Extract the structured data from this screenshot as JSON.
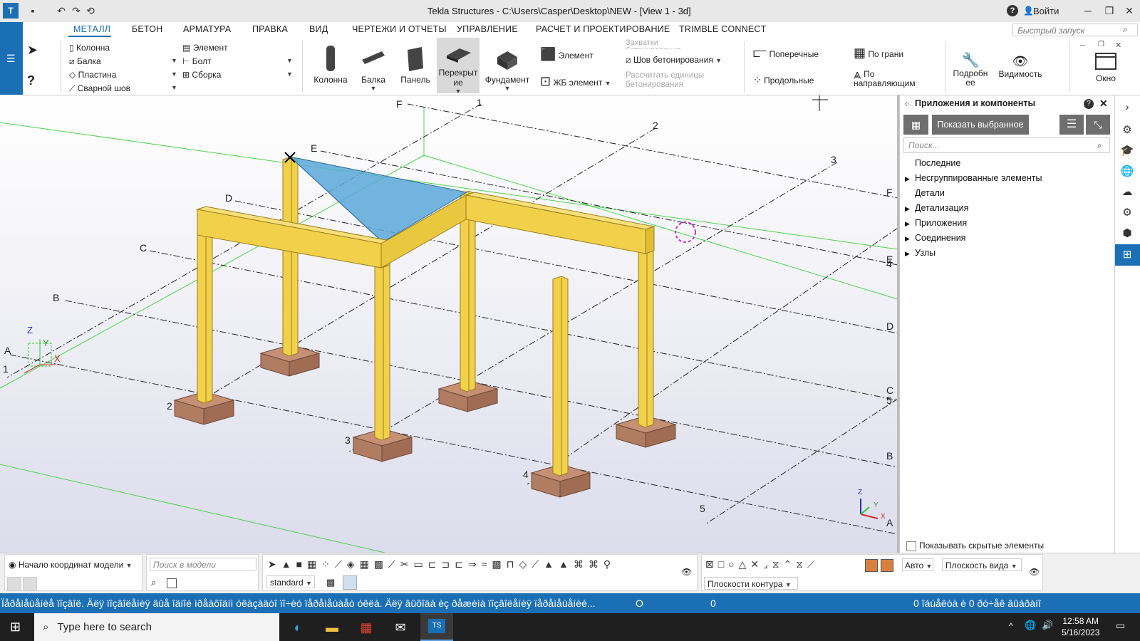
{
  "window": {
    "title": "Tekla Structures - C:\\Users\\Casper\\Desktop\\NEW - [View 1 - 3d]",
    "help": "?",
    "login": "Войти"
  },
  "tabs": [
    "МЕТАЛЛ",
    "БЕТОН",
    "АРМАТУРА",
    "ПРАВКА",
    "ВИД",
    "ЧЕРТЕЖИ И ОТЧЕТЫ",
    "УПРАВЛЕНИЕ",
    "РАСЧЕТ И ПРОЕКТИРОВАНИЕ",
    "TRIMBLE CONNECT"
  ],
  "quick_launch_placeholder": "Быстрый запуск",
  "ribbon": {
    "steel_small": [
      "Колонна",
      "Балка",
      "Пластина",
      "Сварной шов"
    ],
    "steel_small2": [
      "Элемент",
      "Болт",
      "Сборка"
    ],
    "concrete_big": [
      "Колонна",
      "Балка",
      "Панель",
      "Перекрыт ие",
      "Фундамент"
    ],
    "concrete_small": [
      "Элемент",
      "ЖБ элемент"
    ],
    "pour": [
      "Захватки бетонирования",
      "Шов бетонирования",
      "Рассчитать единицы бетонирования"
    ],
    "rebar": [
      "Поперечные",
      "Продольные",
      "По грани",
      "По направляющим"
    ],
    "view": [
      "Подробн ее",
      "Видимость",
      "Окно"
    ]
  },
  "grid_labels": {
    "letters_left": [
      "F",
      "E",
      "D",
      "C",
      "B",
      "A"
    ],
    "letters_right": [
      "F",
      "E",
      "D",
      "C",
      "B",
      "A"
    ],
    "numbers_top": [
      "1",
      "2",
      "3"
    ],
    "numbers_bottom": [
      "1",
      "2",
      "3",
      "4",
      "5"
    ],
    "numbers_right": [
      "4",
      "5"
    ]
  },
  "axes": {
    "z": "Z",
    "y": "Y",
    "x": "X"
  },
  "panel": {
    "title": "Приложения и компоненты",
    "show_selected": "Показать выбранное",
    "search_placeholder": "Поиск...",
    "tree": [
      {
        "label": "Последние",
        "expandable": false
      },
      {
        "label": "Несгруппированные элементы",
        "expandable": true
      },
      {
        "label": "Детали",
        "expandable": false
      },
      {
        "label": "Детализация",
        "expandable": true
      },
      {
        "label": "Приложения",
        "expandable": true
      },
      {
        "label": "Соединения",
        "expandable": true
      },
      {
        "label": "Узлы",
        "expandable": true
      }
    ],
    "show_hidden": "Показывать скрытые элементы"
  },
  "bottom": {
    "origin": "Начало координат модели",
    "search_model": "Поиск в модели",
    "standard": "standard",
    "auto": "Авто",
    "view_plane": "Плоскость вида",
    "contour_planes": "Плоскости контура"
  },
  "status": {
    "message": "Ïåðåìåùåíèå ïîçâîë. Äëÿ ïîçâîëåíèÿ âûå îäíîé ìðåàõîäíì óêàçàäòî ïî÷èó ïåðåìåùàåò óêëà. Äëÿ âûõîäà èç ðåæèìà ïîçâîëåíèÿ ïåðåìåùåíèé...",
    "o": "O",
    "zero": "0",
    "selection": "0 îáúåêòà è 0 ðó÷åê âûáðàíî"
  },
  "taskbar": {
    "search": "Type here to search",
    "time": "12:58 AM",
    "date": "5/16/2023"
  },
  "colors": {
    "accent": "#1a6fb5",
    "steel": "#f2d14a",
    "footing": "#b8826a",
    "plate": "#5aa8d8"
  }
}
